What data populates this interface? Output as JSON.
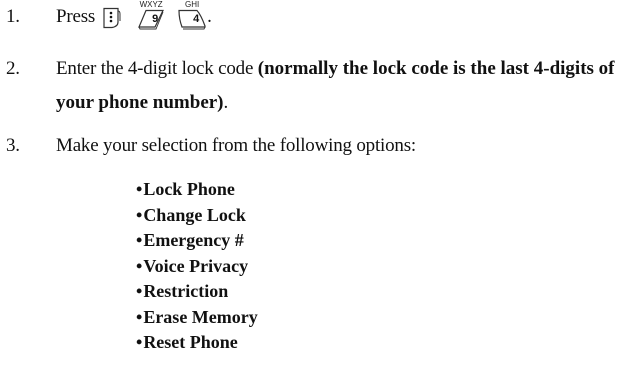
{
  "steps": [
    {
      "number": "1.",
      "text": "Press",
      "keys": [
        {
          "icon": "menu-key-icon",
          "caption": "",
          "digit": ""
        },
        {
          "icon": "key-9-icon",
          "caption": "WXYZ",
          "digit": "9"
        },
        {
          "icon": "key-4-icon",
          "caption": "GHI",
          "digit": "4"
        }
      ],
      "suffix": "."
    },
    {
      "number": "2.",
      "text": "Enter the 4-digit lock code ",
      "bold_text": "(normally the lock code is the last 4-digits of your phone number)",
      "suffix": "."
    },
    {
      "number": "3.",
      "text": "Make your selection from the following options:"
    }
  ],
  "options": {
    "bullet": "•",
    "items": [
      "Lock Phone",
      "Change Lock",
      "Emergency #",
      "Voice Privacy",
      "Restriction",
      "Erase Memory",
      "Reset Phone"
    ]
  }
}
